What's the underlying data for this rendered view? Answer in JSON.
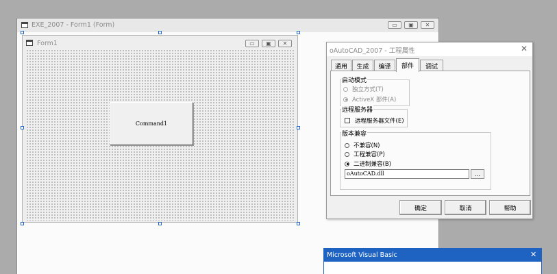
{
  "mdi_window": {
    "title": "EXE_2007 - Form1 (Form)",
    "min": "▭",
    "max": "▣",
    "close": "✕"
  },
  "form_window": {
    "title": "Form1",
    "command_button": "Command1",
    "min": "▭",
    "max": "▣",
    "close": "✕"
  },
  "properties_dialog": {
    "title": "oAutoCAD_2007 - 工程属性",
    "close": "✕",
    "tabs": [
      "通用",
      "生成",
      "编译",
      "部件",
      "调试"
    ],
    "active_tab": "部件",
    "startup_mode": {
      "label": "启动模式",
      "options": [
        {
          "label": "独立方式(T)",
          "selected": false,
          "enabled": false
        },
        {
          "label": "ActiveX 部件(A)",
          "selected": true,
          "enabled": false
        }
      ]
    },
    "remote_server": {
      "label": "远程服务器",
      "checkbox": {
        "label": "远程服务器文件(E)",
        "checked": false
      }
    },
    "version_compat": {
      "label": "版本兼容",
      "options": [
        {
          "label": "不兼容(N)",
          "selected": false
        },
        {
          "label": "工程兼容(P)",
          "selected": false
        },
        {
          "label": "二进制兼容(B)",
          "selected": true
        }
      ],
      "file_value": "oAutoCAD.dll",
      "browse_label": "..."
    },
    "buttons": {
      "ok": "确定",
      "cancel": "取消",
      "help": "帮助"
    }
  },
  "message_box": {
    "title": "Microsoft Visual Basic",
    "close": "✕"
  },
  "colors": {
    "vb_title_blue": "#1e62c2",
    "desktop": "#ababab"
  }
}
